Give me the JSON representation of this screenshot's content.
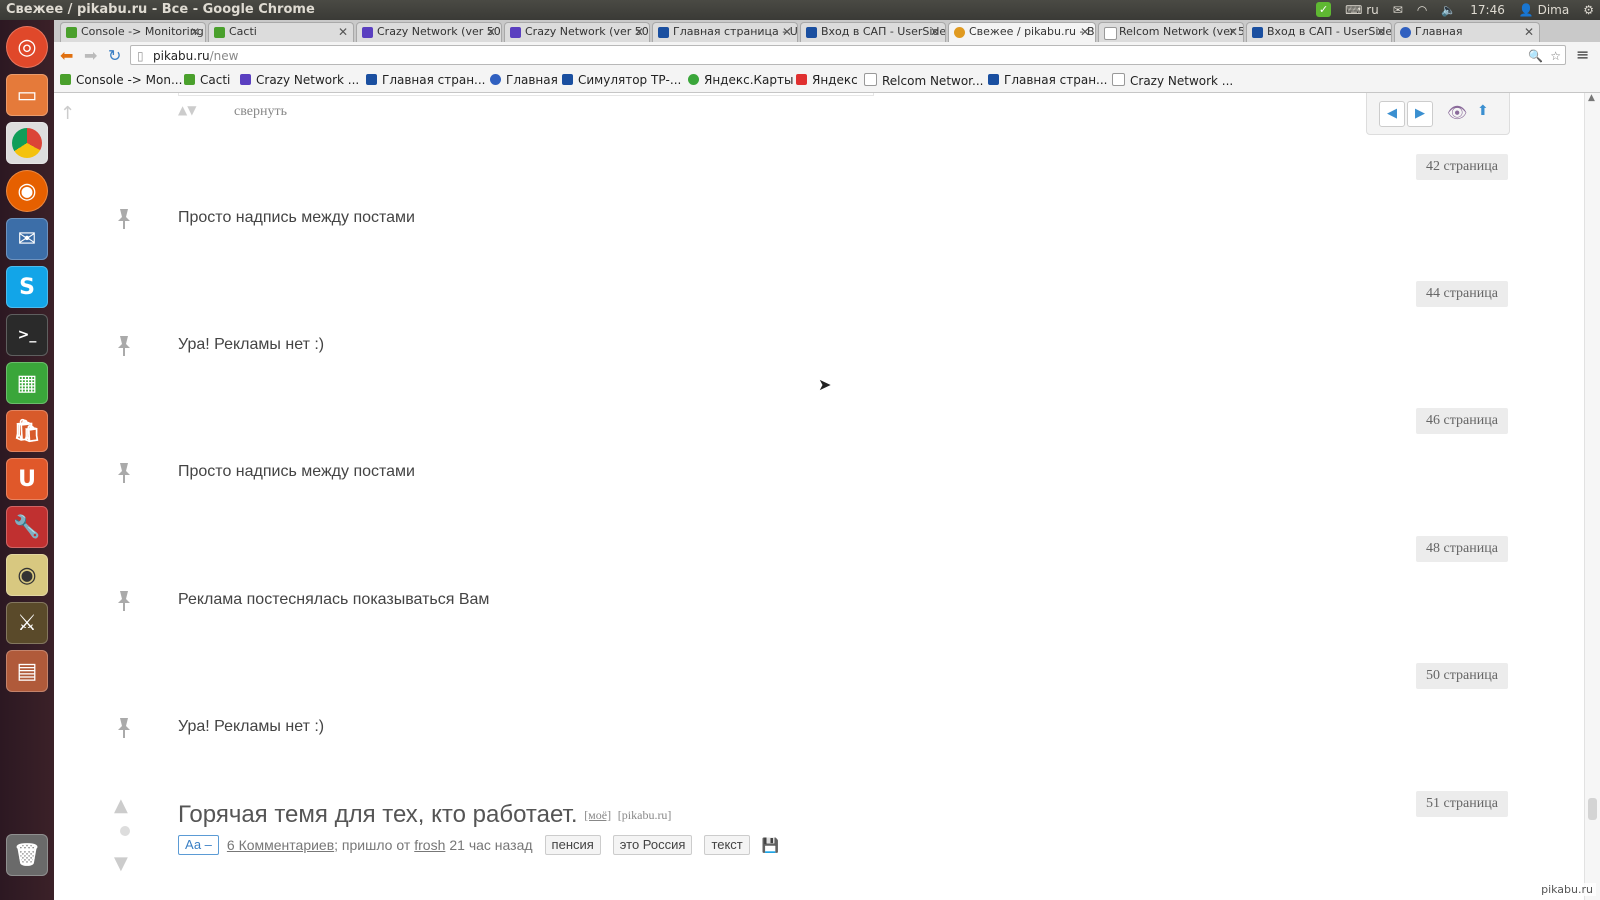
{
  "window": {
    "title": "Свежее / pikabu.ru - Все - Google Chrome"
  },
  "tray": {
    "keyboard": "ru",
    "time": "17:46",
    "user": "Dima"
  },
  "tabs": [
    {
      "label": "Console -> Monitoring",
      "color": "#4aa02c"
    },
    {
      "label": "Cacti",
      "color": "#4aa02c"
    },
    {
      "label": "Crazy Network (ver 50.",
      "color": "#5a3fc0"
    },
    {
      "label": "Crazy Network (ver 50.",
      "color": "#5a3fc0"
    },
    {
      "label": "Главная страница - Use",
      "color": "#1a4fa0"
    },
    {
      "label": "Вход в САП - UserSide",
      "color": "#1a4fa0"
    },
    {
      "label": "Свежее / pikabu.ru - Вс",
      "color": "#e09a20"
    },
    {
      "label": "Relcom Network (ver 5",
      "color": "#999999"
    },
    {
      "label": "Вход в САП - UserSide",
      "color": "#1a4fa0"
    },
    {
      "label": "Главная",
      "color": "#3060c0"
    }
  ],
  "omnibox": {
    "host": "pikabu.ru",
    "path": "/new"
  },
  "bookmarks": [
    {
      "label": "Console -> Mon...",
      "color": "#4aa02c"
    },
    {
      "label": "Cacti",
      "color": "#4aa02c"
    },
    {
      "label": "Crazy Network ...",
      "color": "#5a3fc0"
    },
    {
      "label": "Главная стран...",
      "color": "#1a4fa0"
    },
    {
      "label": "Главная",
      "color": "#3060c0"
    },
    {
      "label": "Симулятор ТР-...",
      "color": "#1a4fa0"
    },
    {
      "label": "Яндекс.Карты",
      "color": "#3aa63a"
    },
    {
      "label": "Яндекс",
      "color": "#e03030"
    },
    {
      "label": "Relcom Networ...",
      "color": "#999999"
    },
    {
      "label": "Главная стран...",
      "color": "#1a4fa0"
    },
    {
      "label": "Crazy Network ...",
      "color": "#999999"
    }
  ],
  "collapse_label": "свернуть",
  "page_badges": [
    "42 страница",
    "44 страница",
    "46 страница",
    "48 страница",
    "50 страница",
    "51 страница"
  ],
  "messages": [
    "Просто надпись между постами",
    "Ура! Рекламы нет :)",
    "Просто надпись между постами",
    "Реклама постеснялась показываться Вам",
    "Ура! Рекламы нет :)"
  ],
  "post": {
    "title": "Горячая темя для тех, кто работает.",
    "mine": "[моё]",
    "source": "[pikabu.ru]",
    "font_toggle": "Аа –",
    "comments": "6 Комментариев",
    "came_from": "; пришло от",
    "author": "frosh",
    "time_ago": "21 час назад",
    "tags": [
      "пенсия",
      "это Россия",
      "текст"
    ]
  },
  "watermark": "pikabu.ru"
}
